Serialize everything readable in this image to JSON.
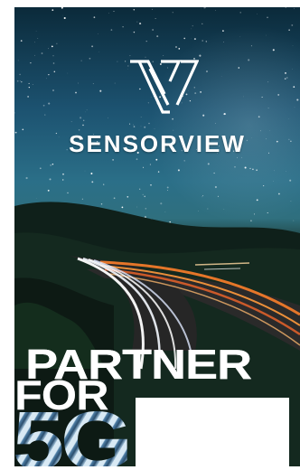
{
  "brand": {
    "name": "SENSORVIEW"
  },
  "headline": {
    "line1": "PARTNER",
    "line2": "FOR",
    "line3": "5G"
  },
  "colors": {
    "sky_top": "#0b2a3a",
    "sky_mid": "#2b6f88",
    "light_trail_white": "#ffffff",
    "light_trail_orange": "#f07a2a",
    "headline_5g": "#7fa9c6"
  },
  "icons": {
    "logo": "sensorview-v-logo-icon"
  }
}
